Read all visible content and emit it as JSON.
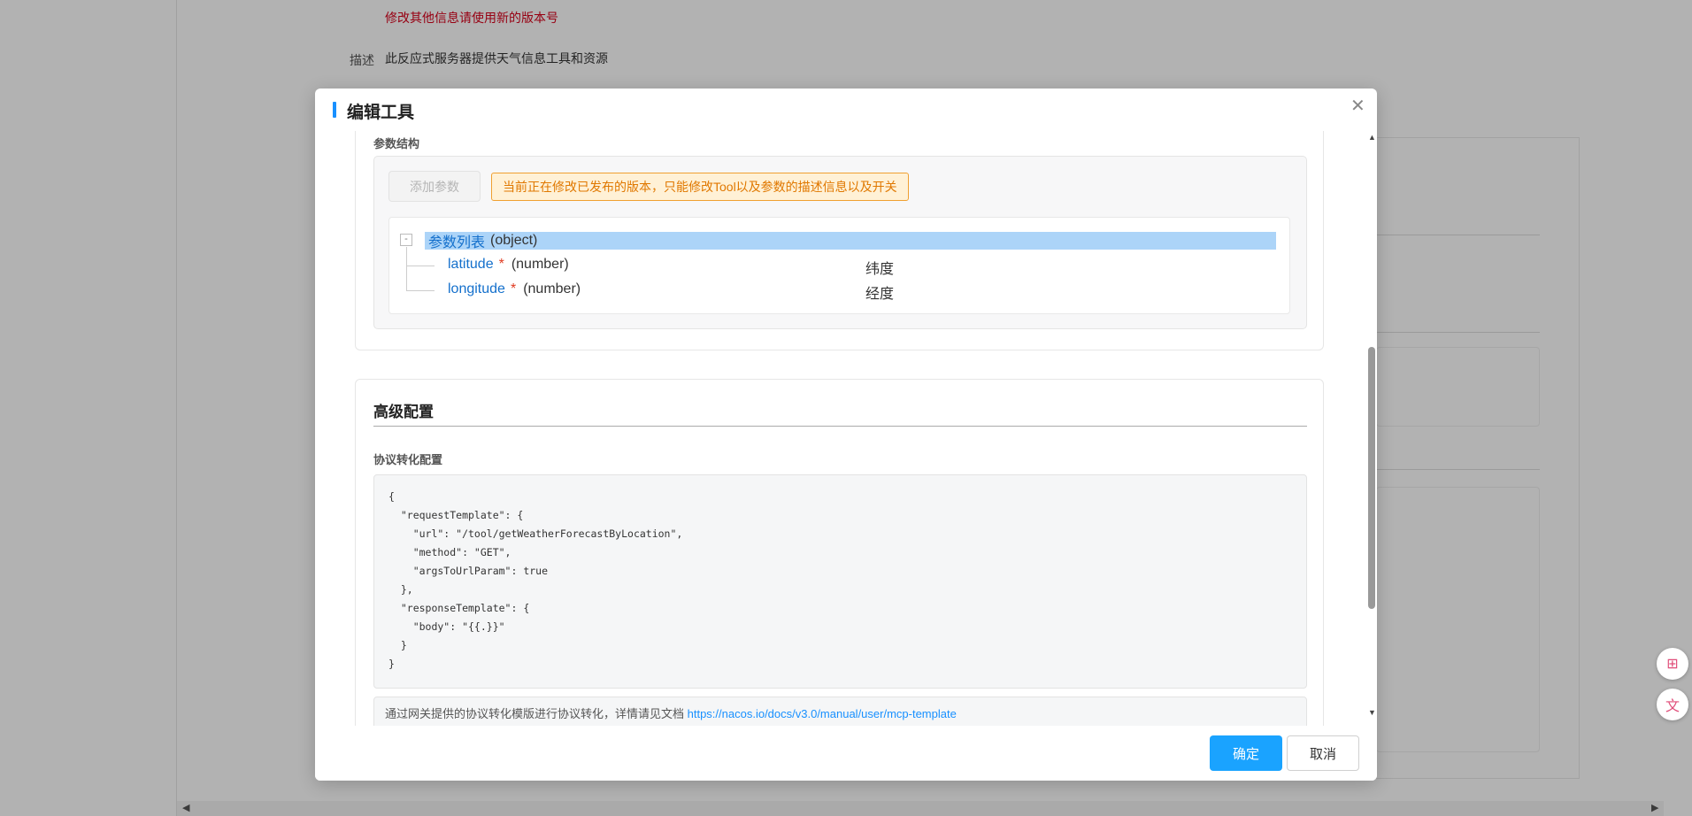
{
  "background": {
    "warning_text": "修改其他信息请使用新的版本号",
    "description_label": "描述",
    "description_value": "此反应式服务器提供天气信息工具和资源"
  },
  "dialog": {
    "title": "编辑工具",
    "close_icon": "close-icon",
    "params_section": {
      "label": "参数结构",
      "add_button": "添加参数",
      "notice": "当前正在修改已发布的版本，只能修改Tool以及参数的描述信息以及开关",
      "tree": {
        "root_name": "参数列表",
        "root_type": "(object)",
        "toggle": "-",
        "params": [
          {
            "name": "latitude",
            "required": "*",
            "type": "(number)",
            "desc": "纬度"
          },
          {
            "name": "longitude",
            "required": "*",
            "type": "(number)",
            "desc": "经度"
          }
        ]
      }
    },
    "advanced": {
      "title": "高级配置",
      "protocol_label": "协议转化配置",
      "code_lines": [
        "{",
        "  \"requestTemplate\": {",
        "    \"url\": \"/tool/getWeatherForecastByLocation\",",
        "    \"method\": \"GET\",",
        "    \"argsToUrlParam\": true",
        "  },",
        "  \"responseTemplate\": {",
        "    \"body\": \"{{.}}\"",
        "  }",
        "}"
      ],
      "hint_text": "通过网关提供的协议转化模版进行协议转化，详情请见文档 ",
      "hint_link": "https://nacos.io/docs/v3.0/manual/user/mcp-template"
    },
    "footer": {
      "ok": "确定",
      "cancel": "取消"
    }
  }
}
